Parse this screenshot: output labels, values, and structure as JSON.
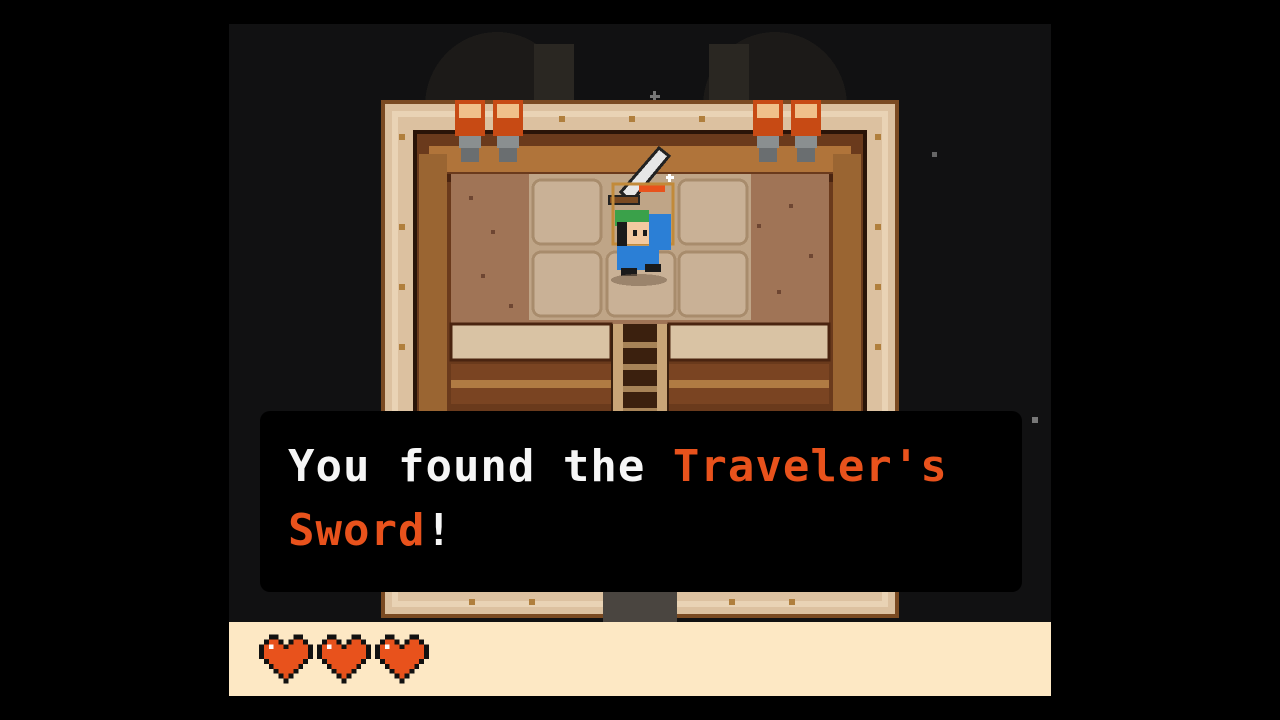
{
  "dialog": {
    "text_before": "You found the ",
    "item_name": "Traveler's Sword",
    "text_after": "!"
  },
  "hud": {
    "hearts_current": 3,
    "hearts_max": 3
  },
  "colors": {
    "background": "#111112",
    "hud_bg": "#fde8c4",
    "heart_fill": "#e8521c",
    "highlight_text": "#e8521c",
    "dialog_bg": "#000000",
    "dialog_text": "#f6f6f6"
  },
  "icons": {
    "heart": "heart-icon",
    "sword": "sword-icon",
    "hero": "hero-sprite",
    "vase": "vase-icon"
  }
}
